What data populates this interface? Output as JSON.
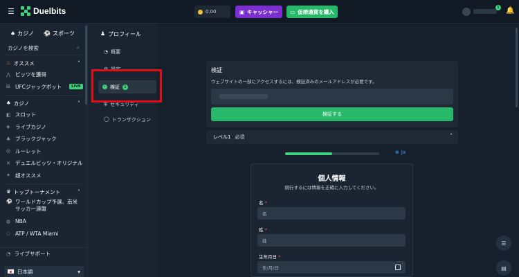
{
  "brand": {
    "name": "Duelbits"
  },
  "header": {
    "balance": "0.00",
    "cashier_label": "キャッシャー",
    "buy_crypto_label": "仮想通貨を購入",
    "notif_count": "5"
  },
  "sidebar": {
    "tab_casino": "カジノ",
    "tab_sports": "スポーツ",
    "search_label": "カジノを検索",
    "sec_featured": "オススメ",
    "featured": [
      {
        "label": "ビッツを獲得"
      },
      {
        "label": "UFCジャックポット",
        "badge": "LIVE"
      }
    ],
    "sec_casino": "カジノ",
    "casino": [
      {
        "label": "スロット"
      },
      {
        "label": "ライブカジノ"
      },
      {
        "label": "ブラックジャック"
      },
      {
        "label": "ルーレット"
      },
      {
        "label": "デュエルビッツ・オリジナル"
      },
      {
        "label": "超オススメ"
      }
    ],
    "sec_tournament": "トップトーナメント",
    "tournaments": [
      {
        "label": "ワールドカップ予選、南米サッカー連盟"
      },
      {
        "label": "NBA"
      },
      {
        "label": "ATP / WTA Miami"
      }
    ],
    "support": "ライブサポート",
    "language": "日本語"
  },
  "profile_nav": {
    "title": "プロフィール",
    "items": [
      {
        "label": "概要"
      },
      {
        "label": "設定"
      },
      {
        "label": "検証",
        "count": "1"
      },
      {
        "label": "セキュリティ"
      },
      {
        "label": "トランザクション"
      }
    ]
  },
  "verify": {
    "title": "検証",
    "description": "ウェブサイトの一部にアクセスするには、検証済みのメールアドレスが必要です。",
    "button": "検証する"
  },
  "level": {
    "label": "レベル1",
    "status": "必須",
    "progress": 0.5,
    "lang": "Ja"
  },
  "form": {
    "title": "個人情報",
    "subtitle": "続行するには情報を正確に入力してください。",
    "first_name_label": "名",
    "first_name_placeholder": "名",
    "last_name_label": "姓",
    "last_name_placeholder": "姓",
    "dob_label": "生年月日",
    "dob_placeholder": "年/月/日"
  }
}
